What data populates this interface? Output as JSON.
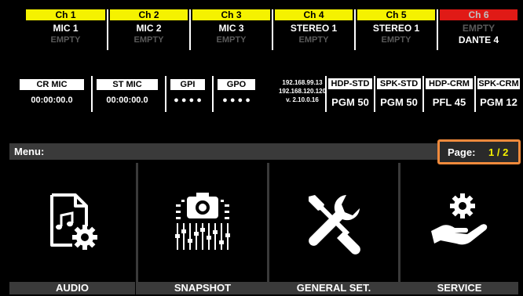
{
  "channels": [
    {
      "header": "Ch 1",
      "line1": "MIC 1",
      "line2": "EMPTY",
      "header_color": "#f5f200"
    },
    {
      "header": "Ch 2",
      "line1": "MIC 2",
      "line2": "EMPTY",
      "header_color": "#f5f200"
    },
    {
      "header": "Ch 3",
      "line1": "MIC 3",
      "line2": "EMPTY",
      "header_color": "#f5f200"
    },
    {
      "header": "Ch 4",
      "line1": "STEREO 1",
      "line2": "EMPTY",
      "header_color": "#f5f200"
    },
    {
      "header": "Ch 5",
      "line1": "STEREO 1",
      "line2": "EMPTY",
      "header_color": "#f5f200"
    },
    {
      "header": "Ch 6",
      "line1": "EMPTY",
      "line2": "DANTE 4",
      "header_color": "#e01a16"
    }
  ],
  "status": {
    "cr_mic": {
      "label": "CR MIC",
      "value": "00:00:00.0"
    },
    "st_mic": {
      "label": "ST MIC",
      "value": "00:00:00.0"
    },
    "gpi": {
      "label": "GPI",
      "value": "● ● ● ●"
    },
    "gpo": {
      "label": "GPO",
      "value": "● ● ● ●"
    },
    "network": {
      "ip1": "192.168.99.13",
      "ip2": "192.168.120.120",
      "version": "v. 2.10.0.16"
    },
    "outputs": [
      {
        "label": "HDP-STD",
        "value": "PGM 50"
      },
      {
        "label": "SPK-STD",
        "value": "PGM 50"
      },
      {
        "label": "HDP-CRM",
        "value": "PFL 45"
      },
      {
        "label": "SPK-CRM",
        "value": "PGM 12"
      }
    ]
  },
  "menu": {
    "label": "Menu:",
    "page_label": "Page:",
    "page_value": "1 / 2",
    "highlight_color": "#f08a3c"
  },
  "tiles": [
    {
      "label": "AUDIO",
      "icon": "audio-file-gear-icon"
    },
    {
      "label": "SNAPSHOT",
      "icon": "camera-faders-icon"
    },
    {
      "label": "GENERAL SET.",
      "icon": "screwdriver-wrench-icon"
    },
    {
      "label": "SERVICE",
      "icon": "hand-gear-icon"
    }
  ]
}
